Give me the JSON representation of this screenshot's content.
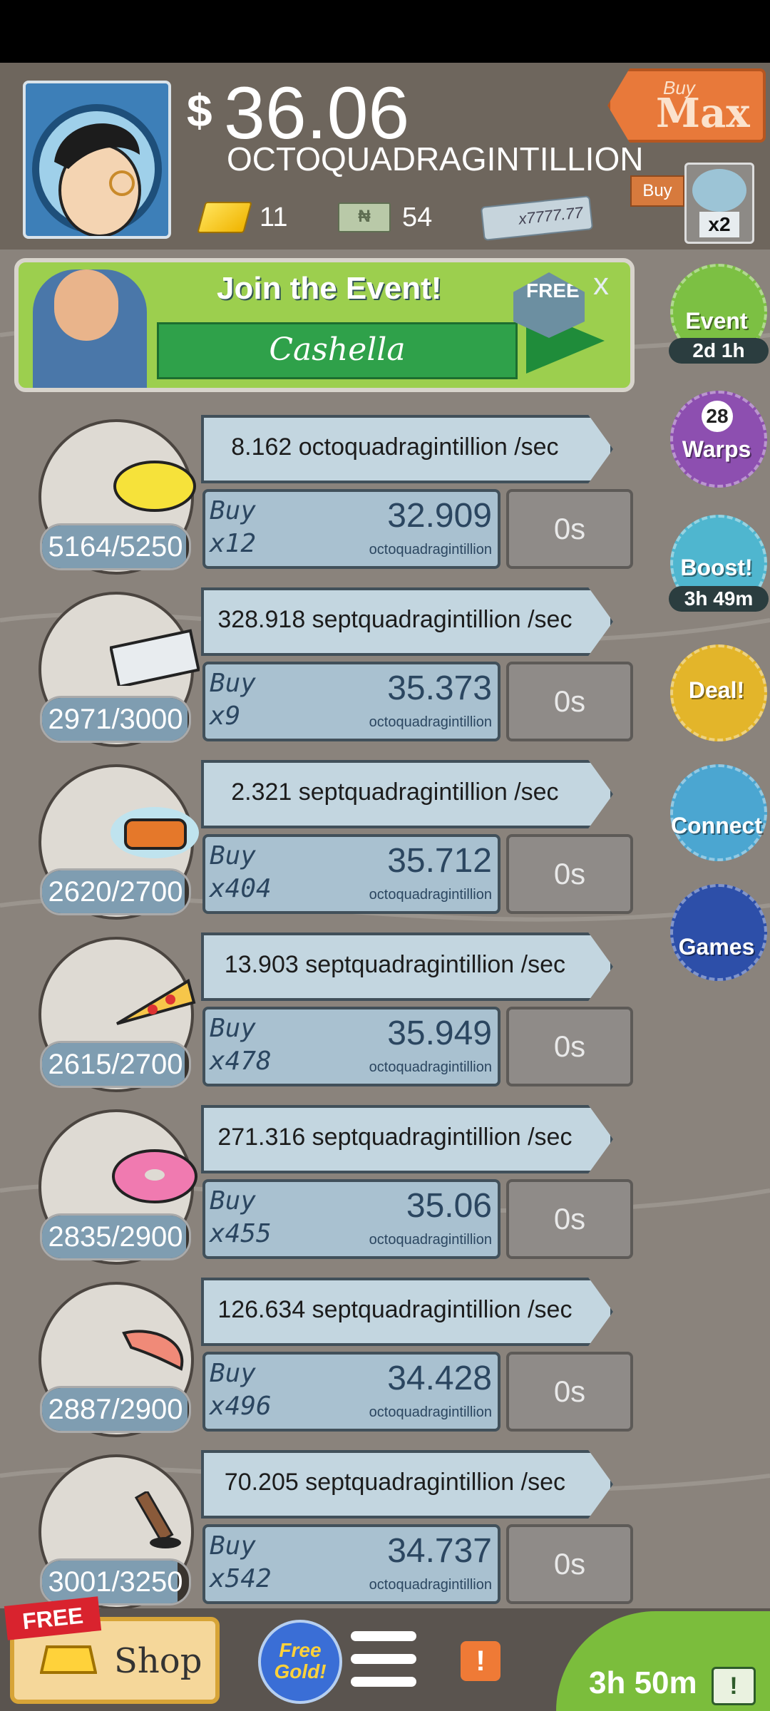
{
  "header": {
    "currency_symbol": "$",
    "money": "36.06",
    "money_unit": "OCTOQUADRAGINTILLION",
    "gold_count": "11",
    "megabucks_count": "54",
    "bill_label": "x7777.77",
    "buy_max_top": "Buy",
    "buy_max_main": "Max",
    "buy_small": "Buy",
    "multiplier": "x2"
  },
  "event": {
    "title": "Join the Event!",
    "name": "Cashella",
    "free": "FREE",
    "close": "x"
  },
  "side": [
    {
      "label": "Event",
      "timer": "2d 1h"
    },
    {
      "label": "Warps",
      "number": "28"
    },
    {
      "label": "Boost!",
      "timer": "3h 49m"
    },
    {
      "label": "Deal!"
    },
    {
      "label": "Connect"
    },
    {
      "label": "Games"
    }
  ],
  "businesses": [
    {
      "icon": "lemon-icon",
      "owned": "5164/5250",
      "fill": 0.98,
      "rate": "8.162 octoquadragintillion /sec",
      "buy": "Buy",
      "qty": "x12",
      "price": "32.909",
      "price_unit": "octoquadragintillion",
      "timer": "0s"
    },
    {
      "icon": "newspaper-icon",
      "owned": "2971/3000",
      "fill": 0.99,
      "rate": "328.918 septquadragintillion /sec",
      "buy": "Buy",
      "qty": "x9",
      "price": "35.373",
      "price_unit": "octoquadragintillion",
      "timer": "0s"
    },
    {
      "icon": "car-icon",
      "owned": "2620/2700",
      "fill": 0.97,
      "rate": "2.321 septquadragintillion /sec",
      "buy": "Buy",
      "qty": "x404",
      "price": "35.712",
      "price_unit": "octoquadragintillion",
      "timer": "0s"
    },
    {
      "icon": "pizza-icon",
      "owned": "2615/2700",
      "fill": 0.97,
      "rate": "13.903 septquadragintillion /sec",
      "buy": "Buy",
      "qty": "x478",
      "price": "35.949",
      "price_unit": "octoquadragintillion",
      "timer": "0s"
    },
    {
      "icon": "donut-icon",
      "owned": "2835/2900",
      "fill": 0.98,
      "rate": "271.316 septquadragintillion /sec",
      "buy": "Buy",
      "qty": "x455",
      "price": "35.06",
      "price_unit": "octoquadragintillion",
      "timer": "0s"
    },
    {
      "icon": "shrimp-icon",
      "owned": "2887/2900",
      "fill": 0.99,
      "rate": "126.634 septquadragintillion /sec",
      "buy": "Buy",
      "qty": "x496",
      "price": "34.428",
      "price_unit": "octoquadragintillion",
      "timer": "0s"
    },
    {
      "icon": "hockey-icon",
      "owned": "3001/3250",
      "fill": 0.92,
      "rate": "70.205 septquadragintillion /sec",
      "buy": "Buy",
      "qty": "x542",
      "price": "34.737",
      "price_unit": "octoquadragintillion",
      "timer": "0s"
    }
  ],
  "bottom": {
    "free_tag": "FREE",
    "shop": "Shop",
    "free_gold": "Free Gold!",
    "alert": "!",
    "tv_timer": "3h 50m",
    "tv_icon": "!"
  },
  "colors": {
    "background": "#8a837c",
    "header": "#6e665d",
    "rate_bar": "#c3d6e0",
    "buy_box": "#a9c1d0"
  }
}
